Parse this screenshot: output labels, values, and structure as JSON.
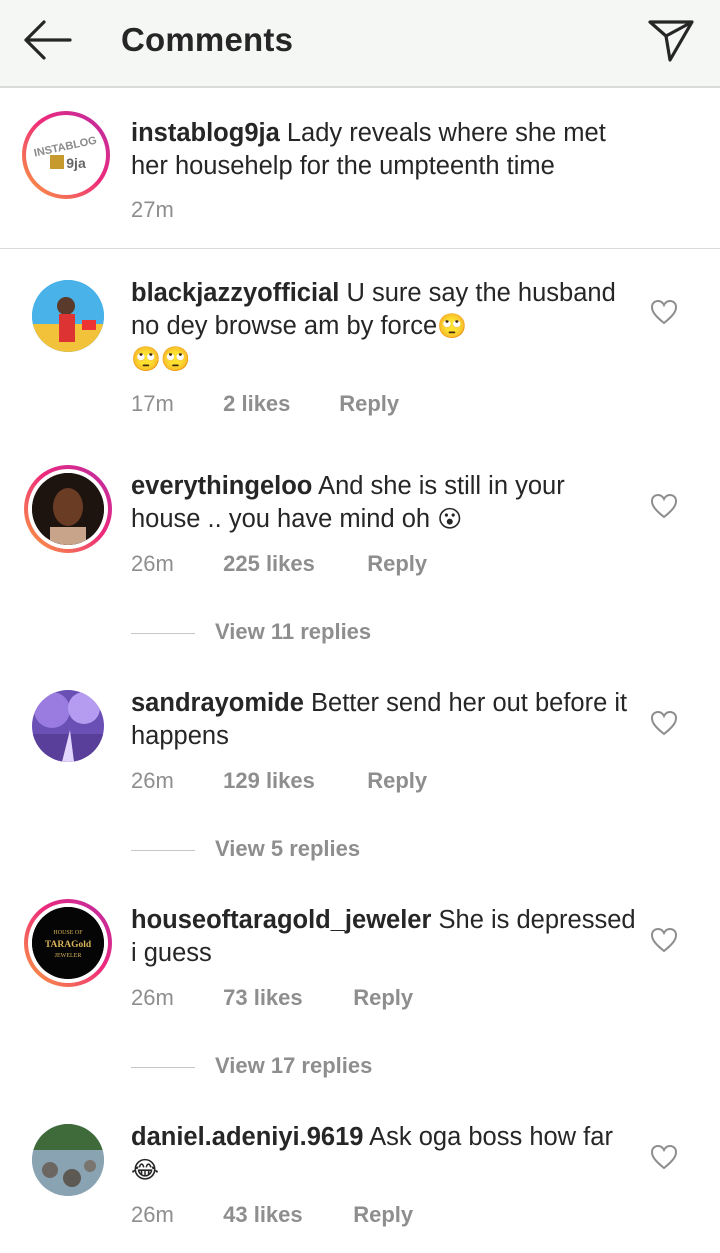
{
  "header": {
    "title": "Comments",
    "back_icon": "back-arrow-icon",
    "share_icon": "send-direct-icon"
  },
  "caption": {
    "username": "instablog9ja",
    "text": "Lady reveals where she met her househelp for the umpteenth time",
    "time": "27m",
    "avatar_text": "INSTABLOG",
    "avatar_text2": "9ja"
  },
  "comments": [
    {
      "username": "blackjazzyofficial",
      "text": "U sure say the husband no dey browse am by force",
      "emoji": "🙄",
      "emoji2": "🙄🙄",
      "time": "17m",
      "likes": "2 likes",
      "reply": "Reply"
    },
    {
      "username": "everythingeloo",
      "text": "And she is still in your house .. you have mind oh",
      "emoji": "😮",
      "time": "26m",
      "likes": "225 likes",
      "reply": "Reply",
      "view_replies": "View 11 replies"
    },
    {
      "username": "sandrayomide",
      "text": "Better send her out before it happens",
      "time": "26m",
      "likes": "129 likes",
      "reply": "Reply",
      "view_replies": "View 5 replies"
    },
    {
      "username": "houseoftaragold_jeweler",
      "text": "She is depressed i guess",
      "time": "26m",
      "likes": "73 likes",
      "reply": "Reply",
      "view_replies": "View 17 replies",
      "avatar_line1": "HOUSE OF",
      "avatar_line2": "TARAGold",
      "avatar_line3": "JEWELER"
    },
    {
      "username": "daniel.adeniyi.9619",
      "text": "Ask oga boss how far",
      "emoji": "😂",
      "time": "26m",
      "likes": "43 likes",
      "reply": "Reply"
    }
  ],
  "colors": {
    "accent_ring_start": "#f9a23c",
    "accent_ring_end": "#b72ca6",
    "meta": "#8e8e8e",
    "text": "#262626"
  }
}
